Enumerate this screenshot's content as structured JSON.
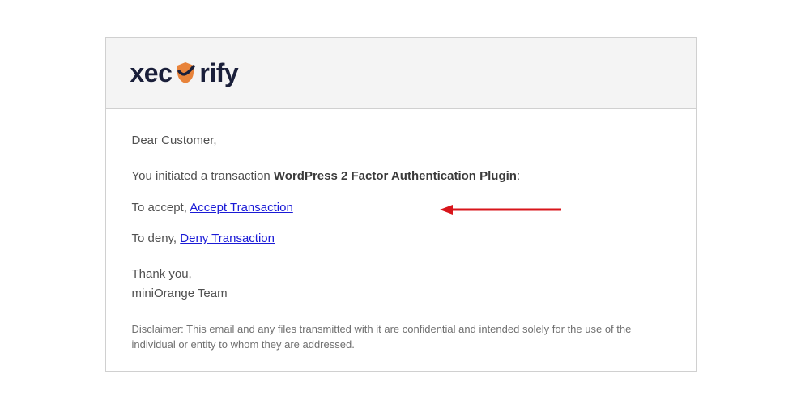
{
  "logo": {
    "part1": "xec",
    "part2": "rify"
  },
  "email": {
    "greeting": "Dear Customer,",
    "initiated_prefix": "You initiated a transaction ",
    "transaction_name": "WordPress 2 Factor Authentication Plugin",
    "initiated_suffix": ":",
    "accept_prefix": "To accept, ",
    "accept_link": "Accept Transaction",
    "deny_prefix": "To deny, ",
    "deny_link": "Deny Transaction",
    "thanks": "Thank you,",
    "team": "miniOrange Team",
    "disclaimer": "Disclaimer: This email and any files transmitted with it are confidential and intended solely for the use of the individual or entity to whom they are addressed."
  }
}
